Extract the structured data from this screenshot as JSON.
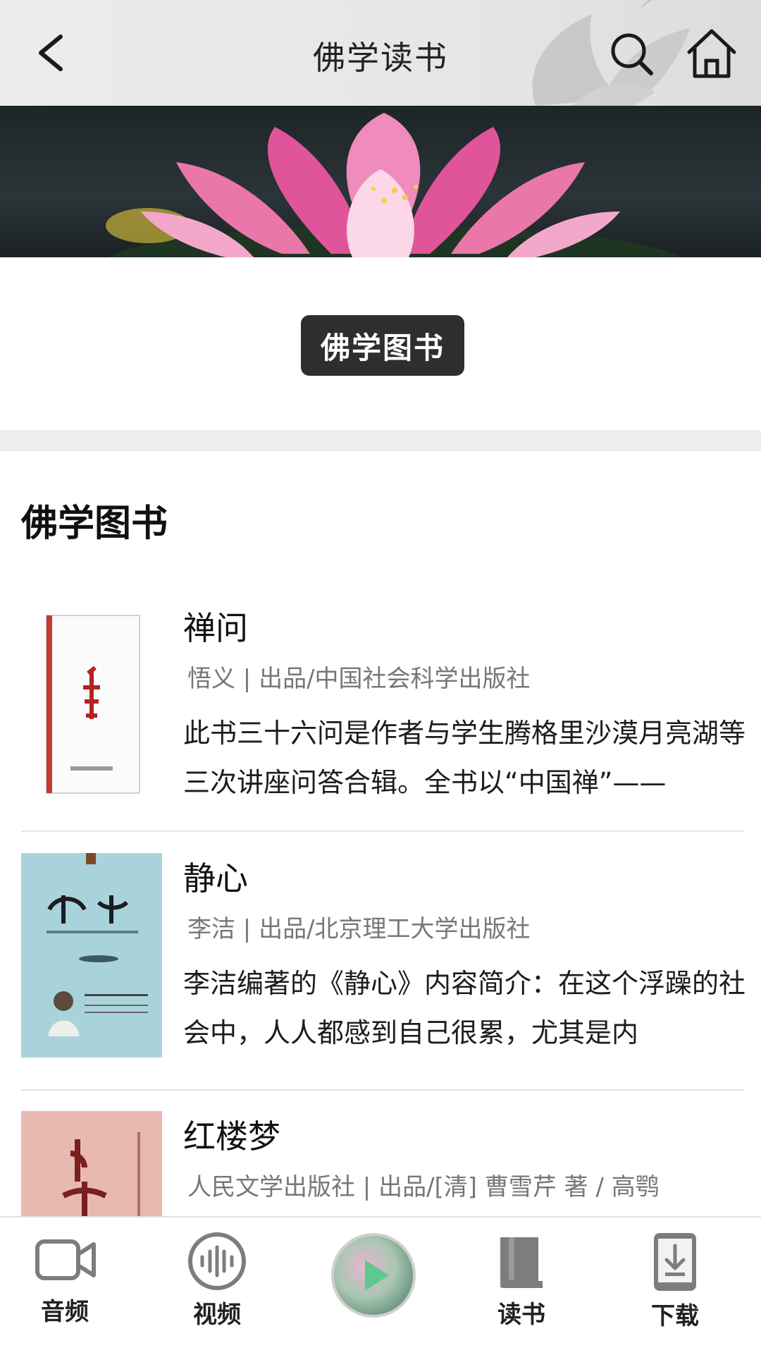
{
  "header": {
    "title": "佛学读书",
    "back_icon": "back-arrow-icon",
    "search_icon": "search-icon",
    "home_icon": "home-icon"
  },
  "category_button": {
    "label": "佛学图书"
  },
  "section": {
    "title": "佛学图书"
  },
  "books": [
    {
      "title": "禅问",
      "meta": "悟义 | 出品/中国社会科学出版社",
      "desc": "此书三十六问是作者与学生腾格里沙漠月亮湖等三次讲座问答合辑。全书以“中国禅”——"
    },
    {
      "title": "静心",
      "meta": "李洁 | 出品/北京理工大学出版社",
      "desc": "李洁编著的《静心》内容简介：在这个浮躁的社会中，人人都感到自己很累，尤其是内"
    },
    {
      "title": "红楼梦",
      "meta": "人民文学出版社 | 出品/[清] 曹雪芹 著 / 高鹗",
      "desc": ""
    }
  ],
  "bottom_nav": {
    "items": [
      {
        "label": "音频",
        "icon": "video-camera-icon"
      },
      {
        "label": "视频",
        "icon": "audio-wave-icon"
      },
      {
        "label": "",
        "icon": "play-icon"
      },
      {
        "label": "读书",
        "icon": "book-icon"
      },
      {
        "label": "下载",
        "icon": "download-icon"
      }
    ]
  },
  "colors": {
    "header_bg": "#e8e8e8",
    "category_button_bg": "#2e2e2e",
    "meta_text": "#777777",
    "lotus_pink": "#e0559a",
    "play_green": "#5ec98f"
  }
}
